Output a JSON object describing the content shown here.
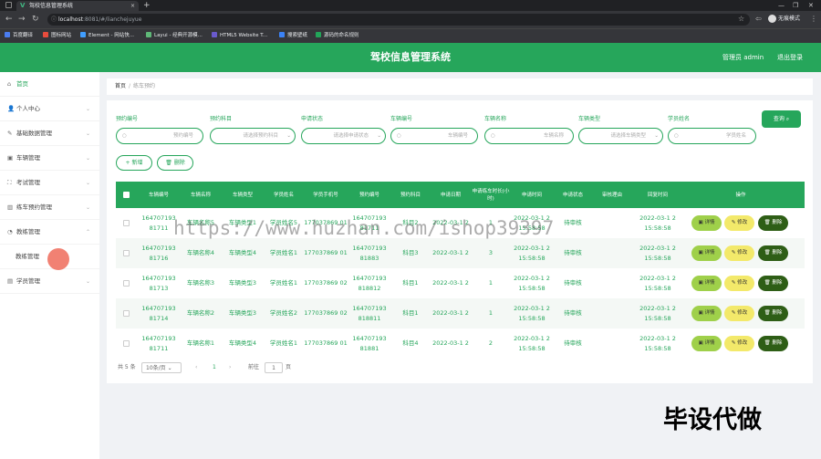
{
  "browser": {
    "tab_title": "驾校信息管理系统",
    "url_host": "localhost",
    "url_path": ":8081/#/lianchejuyue",
    "profile_label": "无痕模式",
    "bookmarks": [
      {
        "label": "百度翻译",
        "color": "#4a7cf0"
      },
      {
        "label": "图标网站",
        "color": "#e84c3d"
      },
      {
        "label": "Element - 网站快...",
        "color": "#409eff"
      },
      {
        "label": "Layui - 经典开源模...",
        "color": "#5fb878"
      },
      {
        "label": "HTML5 Website T...",
        "color": "#6a5acd"
      },
      {
        "label": "搜索壁纸",
        "color": "#3b82f6"
      },
      {
        "label": "源码的命名规则",
        "color": "#22a559"
      }
    ]
  },
  "header": {
    "title": "驾校信息管理系统",
    "user": "管理员 admin",
    "logout": "退出登录",
    "bg_color": "#26a65b"
  },
  "sidebar": {
    "items": [
      {
        "label": "首页",
        "icon": "home-icon"
      },
      {
        "label": "个人中心",
        "icon": "user-icon"
      },
      {
        "label": "基础数据管理",
        "icon": "database-icon"
      },
      {
        "label": "车辆管理",
        "icon": "car-icon"
      },
      {
        "label": "考试管理",
        "icon": "exam-icon"
      },
      {
        "label": "练车预约管理",
        "icon": "chart-icon"
      },
      {
        "label": "教练管理",
        "icon": "coach-icon"
      },
      {
        "label": "教练管理",
        "icon": ""
      },
      {
        "label": "学员管理",
        "icon": "student-icon"
      }
    ]
  },
  "breadcrumb": {
    "home": "首页",
    "separator": "/",
    "current": "练车预约"
  },
  "filters": [
    {
      "label": "预约编号",
      "placeholder": "预约编号",
      "type": "input"
    },
    {
      "label": "预约科目",
      "placeholder": "请选择预约科目",
      "type": "select"
    },
    {
      "label": "申请状态",
      "placeholder": "请选择申请状态",
      "type": "select"
    },
    {
      "label": "车辆编号",
      "placeholder": "车辆编号",
      "type": "input"
    },
    {
      "label": "车辆名称",
      "placeholder": "车辆名称",
      "type": "input"
    },
    {
      "label": "车辆类型",
      "placeholder": "请选择车辆类型",
      "type": "select"
    },
    {
      "label": "学员姓名",
      "placeholder": "学员姓名",
      "type": "input"
    }
  ],
  "buttons": {
    "query": "查询",
    "add": "新增",
    "delete": "删除"
  },
  "table": {
    "headers": [
      "车辆编号",
      "车辆名称",
      "车辆类型",
      "学员姓名",
      "学员手机号",
      "预约编号",
      "预约科目",
      "申请日期",
      "申请练车时长(小时)",
      "申请时间",
      "申请状态",
      "审核理由",
      "回复时间",
      "操作"
    ],
    "rows": [
      [
        "164707193 81711",
        "车辆名称5",
        "车辆类型1",
        "学员姓名5",
        "177037869 01",
        "164707193 81711",
        "科目2",
        "2022-03-1 2",
        "1",
        "2022-03-1 2 15:58:58",
        "待审核",
        "",
        "2022-03-1 2 15:58:58"
      ],
      [
        "164707193 81716",
        "车辆名称4",
        "车辆类型4",
        "学员姓名1",
        "177037869 01",
        "164707193 81883",
        "科目3",
        "2022-03-1 2",
        "3",
        "2022-03-1 2 15:58:58",
        "待审核",
        "",
        "2022-03-1 2 15:58:58"
      ],
      [
        "164707193 81713",
        "车辆名称3",
        "车辆类型3",
        "学员姓名1",
        "177037869 02",
        "164707193 818812",
        "科目1",
        "2022-03-1 2",
        "1",
        "2022-03-1 2 15:58:58",
        "待审核",
        "",
        "2022-03-1 2 15:58:58"
      ],
      [
        "164707193 81714",
        "车辆名称2",
        "车辆类型3",
        "学员姓名2",
        "177037869 02",
        "164707193 818811",
        "科目1",
        "2022-03-1 2",
        "1",
        "2022-03-1 2 15:58:58",
        "待审核",
        "",
        "2022-03-1 2 15:58:58"
      ],
      [
        "164707193 81711",
        "车辆名称1",
        "车辆类型4",
        "学员姓名1",
        "177037869 01",
        "164707193 81881",
        "科目4",
        "2022-03-1 2",
        "2",
        "2022-03-1 2 15:58:58",
        "待审核",
        "",
        "2022-03-1 2 15:58:58"
      ]
    ],
    "action_labels": {
      "detail": "详情",
      "edit": "修改",
      "delete": "删除"
    }
  },
  "pagination": {
    "total": "共 5 条",
    "page_size": "10条/页",
    "current_page": "1",
    "goto_label": "前往",
    "goto_value": "1",
    "page_unit": "页"
  },
  "watermark": "https://www.huzhan.com/ishop39397",
  "overlay_text": "毕设代做"
}
